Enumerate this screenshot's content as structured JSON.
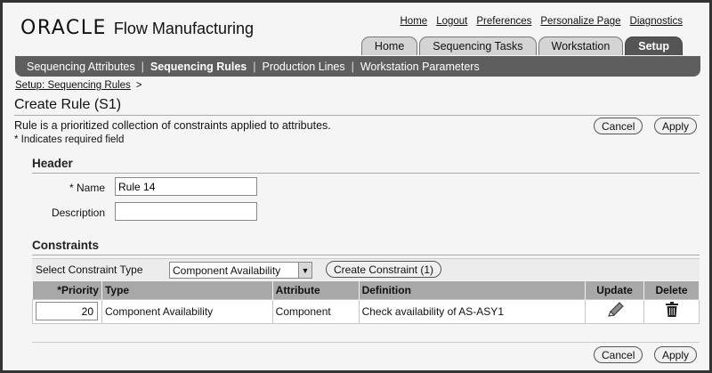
{
  "header": {
    "brand": "ORACLE",
    "product": "Flow Manufacturing",
    "global_links": [
      "Home",
      "Logout",
      "Preferences",
      "Personalize Page",
      "Diagnostics"
    ],
    "tabs": [
      {
        "label": "Home",
        "active": false
      },
      {
        "label": "Sequencing Tasks",
        "active": false
      },
      {
        "label": "Workstation",
        "active": false
      },
      {
        "label": "Setup",
        "active": true
      }
    ]
  },
  "subnav": {
    "items": [
      {
        "label": "Sequencing Attributes",
        "active": false
      },
      {
        "label": "Sequencing Rules",
        "active": true
      },
      {
        "label": "Production Lines",
        "active": false
      },
      {
        "label": "Workstation Parameters",
        "active": false
      }
    ]
  },
  "breadcrumb": {
    "link": "Setup: Sequencing Rules",
    "separator": ">"
  },
  "page": {
    "title": "Create Rule (S1)",
    "description": "Rule is a prioritized collection of constraints applied to attributes.",
    "required_note": "* Indicates required field",
    "cancel_label": "Cancel",
    "apply_label": "Apply"
  },
  "header_section": {
    "heading": "Header",
    "name_label": "* Name",
    "name_value": "Rule 14",
    "description_label": "Description",
    "description_value": ""
  },
  "constraints": {
    "heading": "Constraints",
    "select_label": "Select Constraint Type",
    "select_value": "Component Availability",
    "create_button": "Create Constraint (1)",
    "columns": [
      "*Priority",
      "Type",
      "Attribute",
      "Definition",
      "Update",
      "Delete"
    ],
    "rows": [
      {
        "priority": "20",
        "type": "Component Availability",
        "attribute": "Component",
        "definition": "Check availability of AS-ASY1"
      }
    ]
  },
  "icons": {
    "update": "pencil-icon",
    "delete": "trash-icon"
  }
}
